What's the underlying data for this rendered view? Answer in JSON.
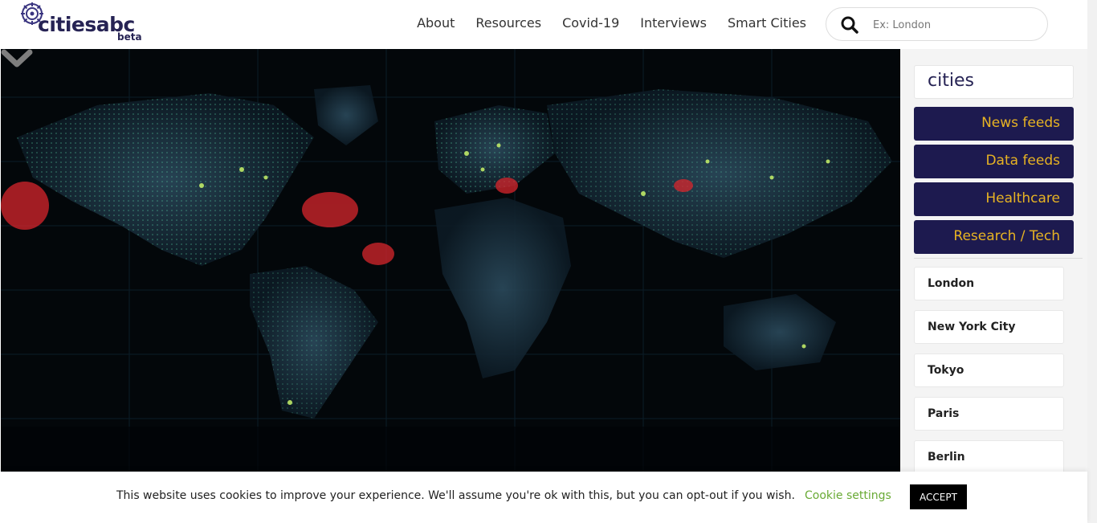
{
  "header": {
    "logo_text": "citiesabc",
    "logo_badge": "beta",
    "nav": [
      "About",
      "Resources",
      "Covid-19",
      "Interviews",
      "Smart Cities"
    ],
    "search_placeholder": "Ex: London"
  },
  "sidebar": {
    "title": "cities",
    "categories": [
      "News feeds",
      "Data feeds",
      "Healthcare",
      "Research / Tech"
    ],
    "cities": [
      "London",
      "New York City",
      "Tokyo",
      "Paris",
      "Berlin"
    ]
  },
  "cookie_bar": {
    "message": "This website uses cookies to improve your experience. We'll assume you're ok with this, but you can opt-out if you wish.",
    "settings_label": "Cookie settings",
    "accept_label": "ACCEPT"
  },
  "colors": {
    "brand_navy": "#1d1a4f",
    "brand_gold": "#e7b323",
    "cookie_link": "#69aa35"
  }
}
